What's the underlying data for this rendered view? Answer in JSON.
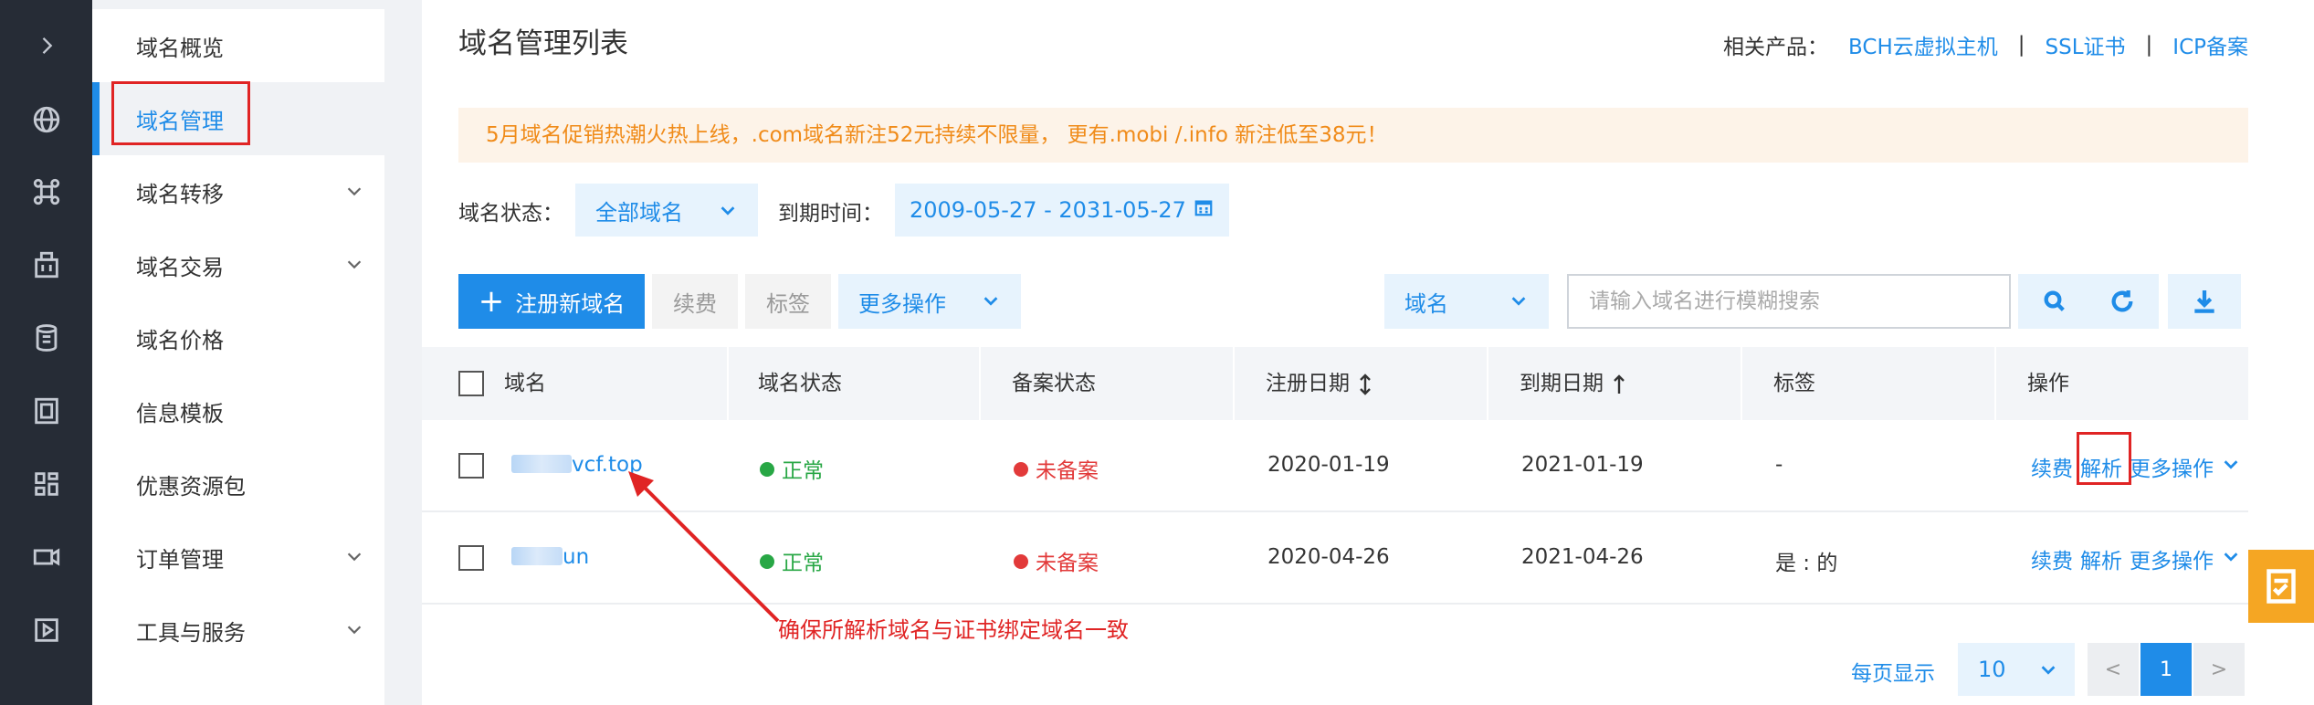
{
  "rail": {
    "expand_icon": "chevron-right-icon",
    "icons": [
      "globe-icon",
      "command-icon",
      "building-icon",
      "database-icon",
      "server-icon",
      "grid-icon",
      "video-icon",
      "play-icon"
    ]
  },
  "menu": {
    "items": [
      {
        "label": "域名概览",
        "expandable": false
      },
      {
        "label": "域名管理",
        "expandable": false,
        "active": true
      },
      {
        "label": "域名转移",
        "expandable": true
      },
      {
        "label": "域名交易",
        "expandable": true
      },
      {
        "label": "域名价格",
        "expandable": false
      },
      {
        "label": "信息模板",
        "expandable": false
      },
      {
        "label": "优惠资源包",
        "expandable": false
      },
      {
        "label": "订单管理",
        "expandable": true
      },
      {
        "label": "工具与服务",
        "expandable": true
      }
    ]
  },
  "header": {
    "title": "域名管理列表",
    "related_label": "相关产品：",
    "related_links": [
      "BCH云虚拟主机",
      "SSL证书",
      "ICP备案"
    ],
    "separator": "|"
  },
  "promo": {
    "text": "5月域名促销热潮火热上线，.com域名新注52元持续不限量， 更有.mobi /.info 新注低至38元！"
  },
  "filters": {
    "status_label": "域名状态：",
    "status_value": "全部域名",
    "expiry_label": "到期时间：",
    "expiry_range": "2009-05-27 - 2031-05-27"
  },
  "toolbar": {
    "register_label": "注册新域名",
    "renew_label": "续费",
    "tag_label": "标签",
    "more_label": "更多操作",
    "search_field": "域名",
    "search_placeholder": "请输入域名进行模糊搜索"
  },
  "table": {
    "headers": [
      "域名",
      "域名状态",
      "备案状态",
      "注册日期",
      "到期日期",
      "标签",
      "操作"
    ],
    "rows": [
      {
        "domain": "vcf.top",
        "status": "正常",
        "beian": "未备案",
        "registered": "2020-01-19",
        "expires": "2021-01-19",
        "tag": "-",
        "actions": [
          "续费",
          "解析",
          "更多操作"
        ]
      },
      {
        "domain": "un",
        "status": "正常",
        "beian": "未备案",
        "registered": "2020-04-26",
        "expires": "2021-04-26",
        "tag": "是 : 的",
        "actions": [
          "续费",
          "解析",
          "更多操作"
        ]
      }
    ]
  },
  "annotation": {
    "text": "确保所解析域名与证书绑定域名一致",
    "color": "#e02424"
  },
  "pagination": {
    "per_page_label": "每页显示",
    "page_size": "10",
    "prev": "<",
    "current": "1",
    "next": ">"
  },
  "colors": {
    "accent": "#1f8ce8",
    "ok": "#28a745",
    "warn": "#e23a3a",
    "promo_text": "#f08b19",
    "float_button": "#f5a623"
  }
}
